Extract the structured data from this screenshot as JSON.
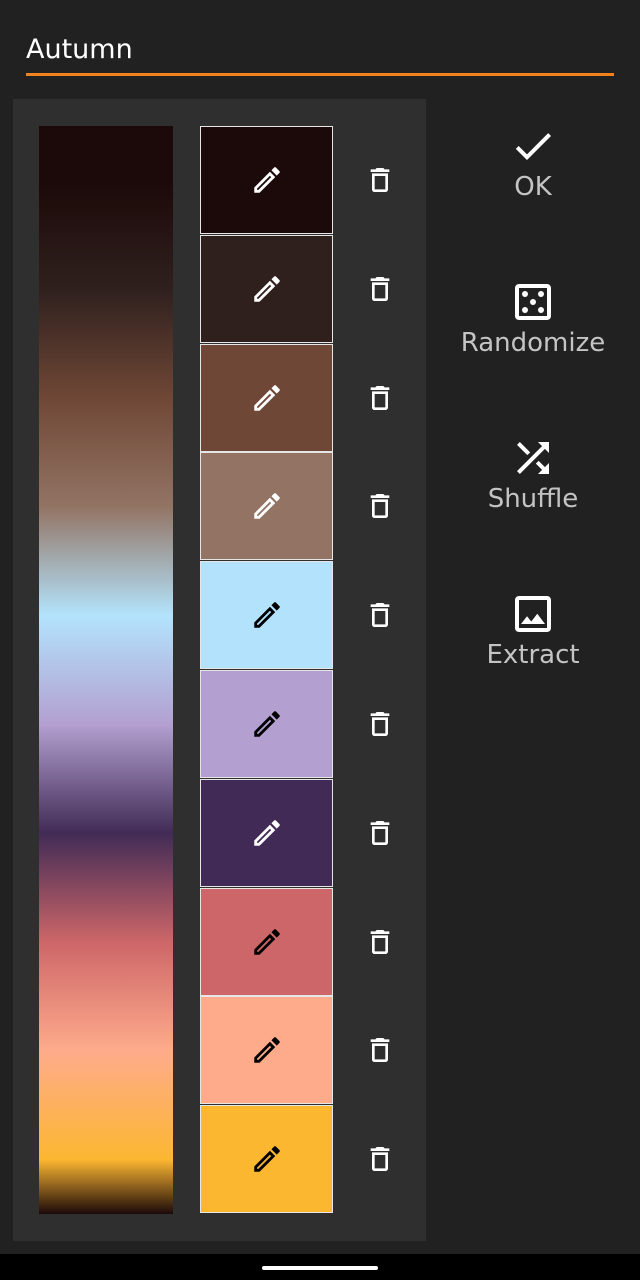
{
  "palette_name": "Autumn",
  "accent_color": "#f0831c",
  "colors": [
    {
      "hex": "#1c0909",
      "icon_color": "#ffffff",
      "edit_icon": "pencil-icon",
      "delete_icon": "trash-icon"
    },
    {
      "hex": "#2f201e",
      "icon_color": "#ffffff",
      "edit_icon": "pencil-icon",
      "delete_icon": "trash-icon"
    },
    {
      "hex": "#6f4736",
      "icon_color": "#ffffff",
      "edit_icon": "pencil-icon",
      "delete_icon": "trash-icon"
    },
    {
      "hex": "#937464",
      "icon_color": "#ffffff",
      "edit_icon": "pencil-icon",
      "delete_icon": "trash-icon"
    },
    {
      "hex": "#b3e3fc",
      "icon_color": "#000000",
      "edit_icon": "pencil-icon",
      "delete_icon": "trash-icon"
    },
    {
      "hex": "#b3a0d0",
      "icon_color": "#000000",
      "edit_icon": "pencil-icon",
      "delete_icon": "trash-icon"
    },
    {
      "hex": "#412b56",
      "icon_color": "#ffffff",
      "edit_icon": "pencil-icon",
      "delete_icon": "trash-icon"
    },
    {
      "hex": "#cd6668",
      "icon_color": "#000000",
      "edit_icon": "pencil-icon",
      "delete_icon": "trash-icon"
    },
    {
      "hex": "#feab8b",
      "icon_color": "#000000",
      "edit_icon": "pencil-icon",
      "delete_icon": "trash-icon"
    },
    {
      "hex": "#fcb731",
      "icon_color": "#000000",
      "edit_icon": "pencil-icon",
      "delete_icon": "trash-icon"
    }
  ],
  "actions": [
    {
      "label": "OK",
      "icon": "check-icon"
    },
    {
      "label": "Randomize",
      "icon": "dice-icon"
    },
    {
      "label": "Shuffle",
      "icon": "shuffle-icon"
    },
    {
      "label": "Extract",
      "icon": "image-icon"
    }
  ]
}
